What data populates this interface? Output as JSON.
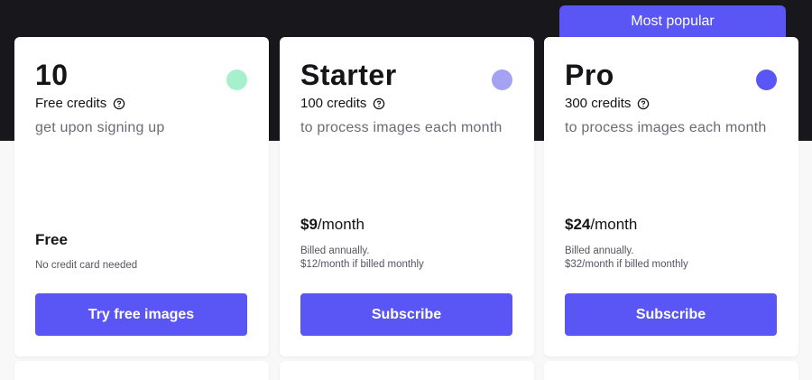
{
  "badge": {
    "label": "Most popular"
  },
  "plans": [
    {
      "title": "10",
      "credits": "Free credits",
      "description": "get upon signing up",
      "dot_color": "#a6f0cd",
      "price_label": "Free",
      "billing_lines": [
        "No credit card needed"
      ],
      "cta": "Try free images"
    },
    {
      "title": "Starter",
      "credits": "100 credits",
      "description": "to process images each month",
      "dot_color": "#a4a3f3",
      "price_amount": "$9",
      "price_period": "/month",
      "billing_lines": [
        "Billed annually.",
        "$12/month if billed monthly"
      ],
      "cta": "Subscribe"
    },
    {
      "title": "Pro",
      "credits": "300 credits",
      "description": "to process images each month",
      "dot_color": "#5a55f5",
      "price_amount": "$24",
      "price_period": "/month",
      "billing_lines": [
        "Billed annually.",
        "$32/month if billed monthly"
      ],
      "cta": "Subscribe"
    }
  ],
  "colors": {
    "accent": "#5a55f5",
    "dark_band": "#17171c",
    "background": "#f8f8f9"
  },
  "icons": {
    "credits_help": "help-circle-icon"
  }
}
